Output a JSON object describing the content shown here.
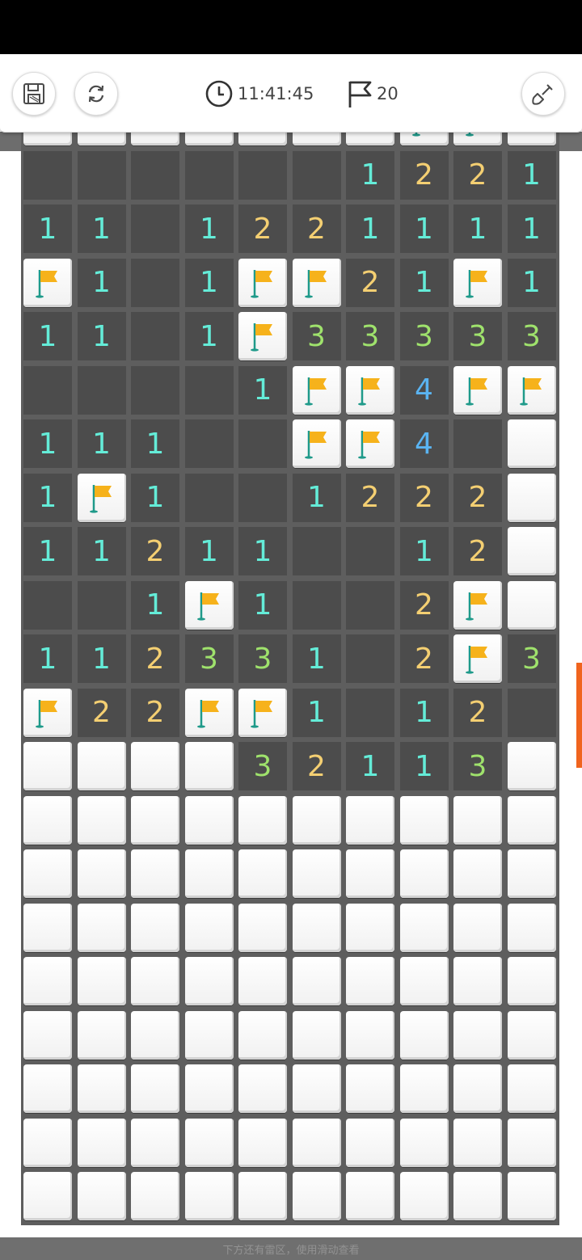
{
  "toolbar": {
    "timer_text": "11:41:45",
    "flag_count": "20",
    "buttons": [
      "save-icon",
      "restart-icon",
      "shovel-icon"
    ]
  },
  "bottom_hint": "下方还有雷区，使用滑动查看",
  "colors": {
    "n1": "#64ecd8",
    "n2": "#f4cf72",
    "n3": "#9fe26c",
    "n4": "#5ab4f2",
    "flag": "#f6b21b",
    "accent": "#f0641e"
  },
  "board": {
    "legend": "C = covered tile, F = flagged tile, 0 = revealed empty, digit = revealed number",
    "rows": [
      "CCCCCCCFFC",
      "0000001221",
      "1101221111",
      "F101FF21F1",
      "1101F33333",
      "00001FF4FF",
      "11100FF40C",
      "1F1001222C",
      "112110012C",
      "001F1002FC",
      "11233102F3",
      "F22FF10120",
      "CCCC32113C",
      "CCCCCCCCCC",
      "CCCCCCCCCC",
      "CCCCCCCCCC",
      "CCCCCCCCCC",
      "CCCCCCCCCC",
      "CCCCCCCCCC",
      "CCCCCCCCCC",
      "CCCCCCCCCC"
    ]
  }
}
